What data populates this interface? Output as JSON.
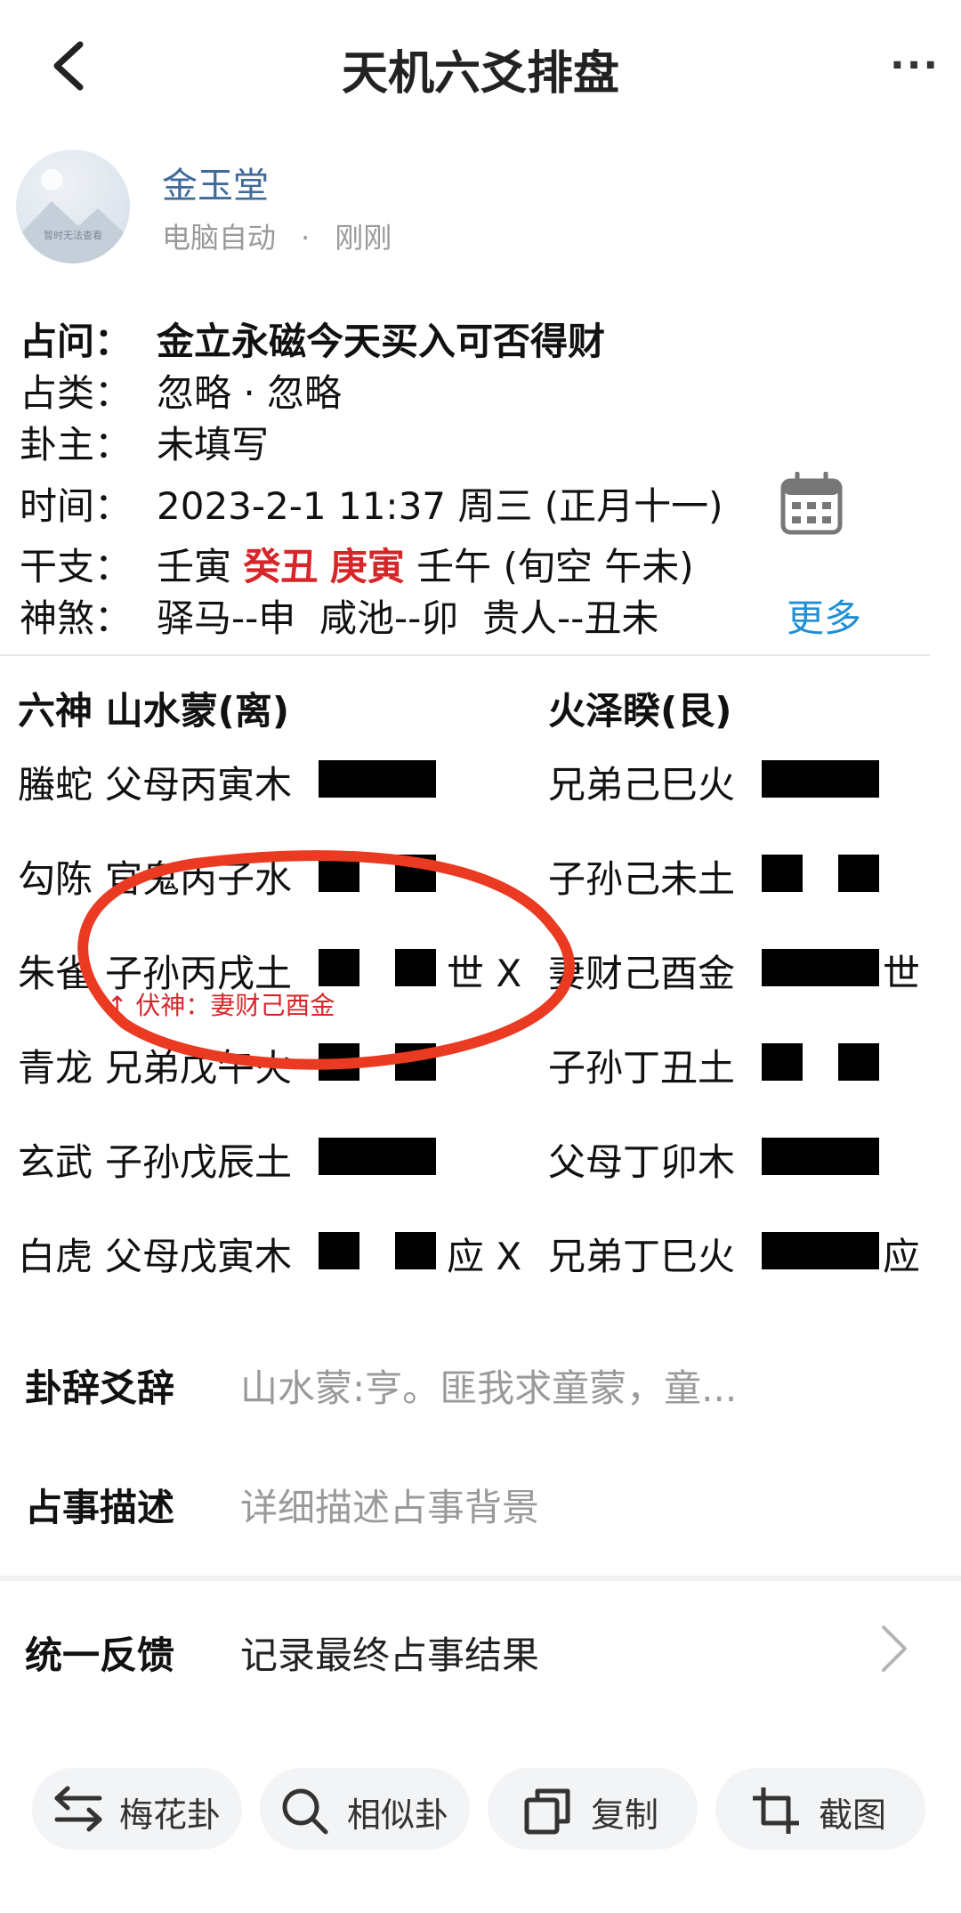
{
  "header": {
    "title": "天机六爻排盘",
    "more_label": "···"
  },
  "author": {
    "name": "金玉堂",
    "source": "电脑自动",
    "time": "刚刚",
    "avatar_caption": "暂时无法查看"
  },
  "info": {
    "question": {
      "label": "占问：",
      "value": "金立永磁今天买入可否得财"
    },
    "category": {
      "label": "占类：",
      "value": "忽略 · 忽略"
    },
    "owner": {
      "label": "卦主：",
      "value": "未填写"
    },
    "time": {
      "label": "时间：",
      "value": "2023-2-1 11:37 周三 (正月十一)"
    },
    "ganzhi": {
      "label": "干支：",
      "p1": "壬寅",
      "p2": "癸丑",
      "p3": "庚寅",
      "p4": "壬午 (旬空 午未)"
    },
    "shensha": {
      "label": "神煞：",
      "value": "驿马--申  咸池--卯  贵人--丑未",
      "more": "更多"
    }
  },
  "hexagram": {
    "header_left": "六神 山水蒙(离)",
    "header_right": "火泽睽(艮)",
    "rows": [
      {
        "shen": "螣蛇",
        "left": "父母丙寅木",
        "left_line": "yang",
        "left_mark": "",
        "right": "兄弟己巳火",
        "right_line": "yang",
        "right_mark": ""
      },
      {
        "shen": "勾陈",
        "left": "官鬼丙子水",
        "left_line": "yin",
        "left_mark": "",
        "right": "子孙己未土",
        "right_line": "yin",
        "right_mark": ""
      },
      {
        "shen": "朱雀",
        "left": "子孙丙戌土",
        "left_line": "yin",
        "left_mark": "世 X",
        "right": "妻财己酉金",
        "right_line": "yang",
        "right_mark": "世"
      },
      {
        "shen": "青龙",
        "left": "兄弟戊午火",
        "left_line": "yin",
        "left_mark": "",
        "right": "子孙丁丑土",
        "right_line": "yin",
        "right_mark": ""
      },
      {
        "shen": "玄武",
        "left": "子孙戊辰土",
        "left_line": "yang",
        "left_mark": "",
        "right": "父母丁卯木",
        "right_line": "yang",
        "right_mark": ""
      },
      {
        "shen": "白虎",
        "left": "父母戊寅木",
        "left_line": "yin",
        "left_mark": "应 X",
        "right": "兄弟丁巳火",
        "right_line": "yang",
        "right_mark": "应"
      }
    ],
    "fushen": "↑ 伏神：妻财己酉金"
  },
  "sections": {
    "guaci": {
      "label": "卦辞爻辞",
      "value": "山水蒙:亨。匪我求童蒙，童..."
    },
    "describe": {
      "label": "占事描述",
      "placeholder": "详细描述占事背景"
    },
    "feedback": {
      "label": "统一反馈",
      "value": "记录最终占事结果"
    }
  },
  "bottom_buttons": [
    {
      "label": "梅花卦",
      "icon": "swap-arrows-icon"
    },
    {
      "label": "相似卦",
      "icon": "search-icon"
    },
    {
      "label": "复制",
      "icon": "copy-icon"
    },
    {
      "label": "截图",
      "icon": "crop-icon"
    }
  ],
  "colors": {
    "accent_red": "#d7262a",
    "link_blue": "#1f8fd6",
    "author_blue": "#3f6a99",
    "annotation_red": "#ea3a22"
  }
}
